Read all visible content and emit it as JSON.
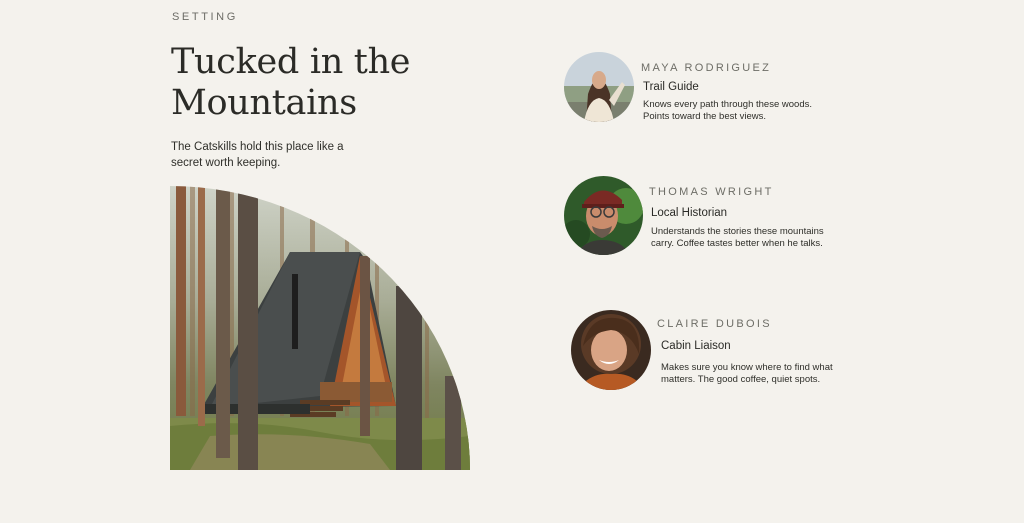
{
  "section": {
    "eyebrow": "SETTING",
    "title": "Tucked in the Mountains",
    "intro": "The Catskills hold this place like a secret worth keeping."
  },
  "photo": {
    "subject": "A-frame cabin among pine trees"
  },
  "people": [
    {
      "name": "MAYA RODRIGUEZ",
      "role": "Trail Guide",
      "description": "Knows every path through these woods. Points toward the best views."
    },
    {
      "name": "THOMAS WRIGHT",
      "role": "Local Historian",
      "description": "Understands the stories these mountains carry. Coffee tastes better when he talks."
    },
    {
      "name": "CLAIRE DUBOIS",
      "role": "Cabin Liaison",
      "description": "Makes sure you know where to find what matters. The good coffee, quiet spots."
    }
  ],
  "colors": {
    "background": "#f4f2ed",
    "text": "#2b2b27",
    "muted": "#6d6d66"
  }
}
